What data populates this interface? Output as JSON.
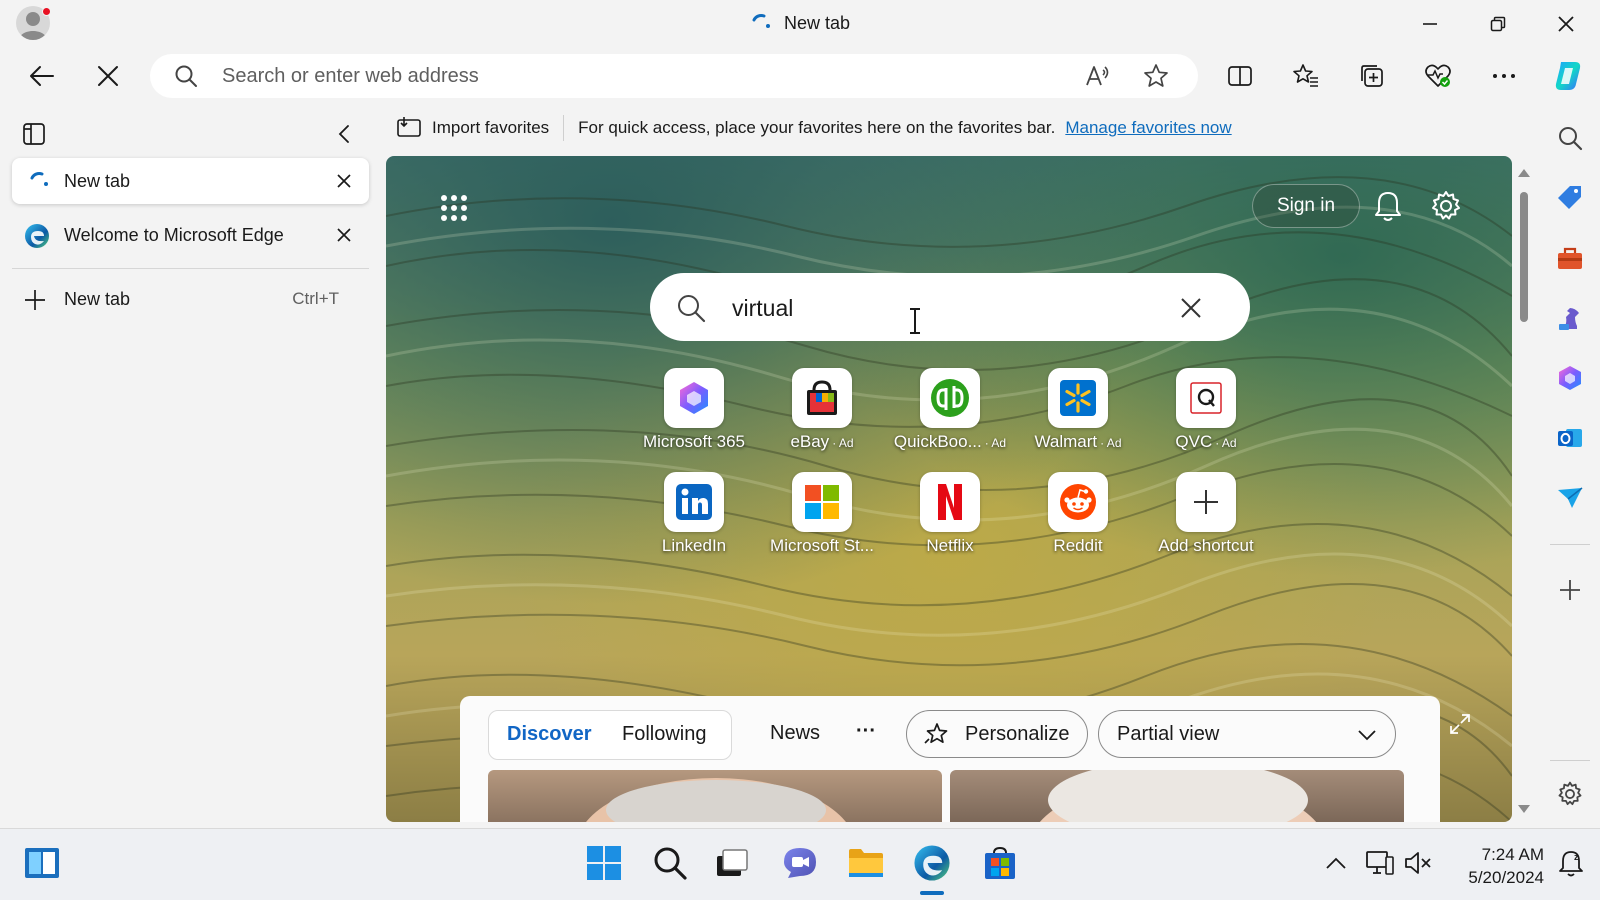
{
  "window": {
    "title": "New tab"
  },
  "toolbar": {
    "address_placeholder": "Search or enter web address"
  },
  "favorites_bar": {
    "import_label": "Import favorites",
    "message": "For quick access, place your favorites here on the favorites bar.",
    "manage_link": "Manage favorites now"
  },
  "tabs": {
    "items": [
      {
        "label": "New tab",
        "active": true
      },
      {
        "label": "Welcome to Microsoft Edge",
        "active": false
      }
    ],
    "new_tab_label": "New tab",
    "new_tab_shortcut": "Ctrl+T"
  },
  "ntp": {
    "sign_in": "Sign in",
    "search_value": "virtual",
    "shortcuts": [
      {
        "name": "Microsoft 365",
        "ad": "",
        "icon": "microsoft-365-icon"
      },
      {
        "name": "eBay",
        "ad": "Ad",
        "icon": "ebay-icon"
      },
      {
        "name": "QuickBoo...",
        "ad": "Ad",
        "icon": "quickbooks-icon"
      },
      {
        "name": "Walmart",
        "ad": "Ad",
        "icon": "walmart-icon"
      },
      {
        "name": "QVC",
        "ad": "Ad",
        "icon": "qvc-icon"
      },
      {
        "name": "LinkedIn",
        "ad": "",
        "icon": "linkedin-icon"
      },
      {
        "name": "Microsoft St...",
        "ad": "",
        "icon": "microsoft-store-icon"
      },
      {
        "name": "Netflix",
        "ad": "",
        "icon": "netflix-icon"
      },
      {
        "name": "Reddit",
        "ad": "",
        "icon": "reddit-icon"
      },
      {
        "name": "Add shortcut",
        "ad": "",
        "icon": "plus-icon"
      }
    ],
    "feed": {
      "tabs": [
        "Discover",
        "Following"
      ],
      "active_tab": "Discover",
      "news": "News",
      "more": "···",
      "personalize": "Personalize",
      "view_mode": "Partial view"
    }
  },
  "taskbar": {
    "time": "7:24 AM",
    "date": "5/20/2024"
  },
  "colors": {
    "accent": "#0f6cbd",
    "discover": "#1166c5",
    "edge_blue": "#0c59a4",
    "netflix_red": "#e50914",
    "reddit_orange": "#ff4500",
    "walmart_blue": "#0071ce",
    "walmart_yellow": "#ffc220"
  }
}
